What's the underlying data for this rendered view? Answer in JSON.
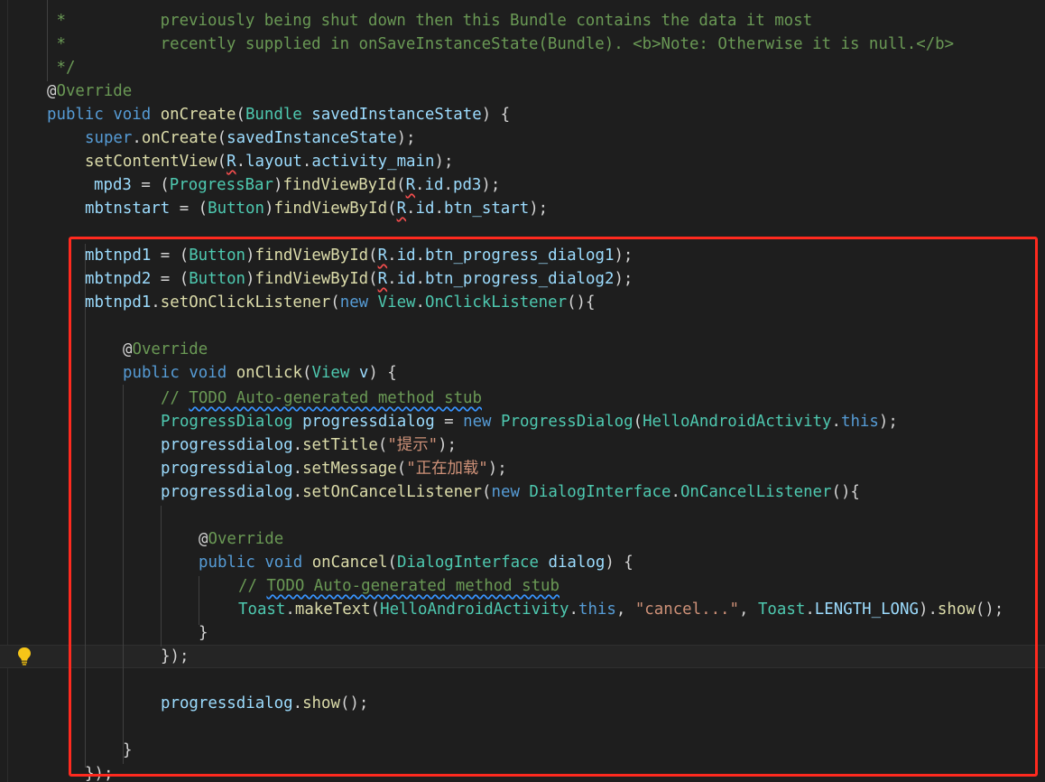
{
  "editor": {
    "lines": [
      [
        {
          "t": " *          previously being shut down then this Bundle contains the data it most",
          "c": "cm"
        }
      ],
      [
        {
          "t": " *          recently supplied in onSaveInstanceState(Bundle). <b>Note: Otherwise it is null.</b>",
          "c": "cm"
        }
      ],
      [
        {
          "t": " */",
          "c": "cm"
        }
      ],
      [
        {
          "t": "@",
          "c": "an"
        },
        {
          "t": "Override",
          "c": "cm"
        }
      ],
      [
        {
          "t": "public",
          "c": "kw"
        },
        {
          "t": " ",
          "c": "pl"
        },
        {
          "t": "void",
          "c": "kw"
        },
        {
          "t": " ",
          "c": "pl"
        },
        {
          "t": "onCreate",
          "c": "fn"
        },
        {
          "t": "(",
          "c": "pl"
        },
        {
          "t": "Bundle",
          "c": "ty"
        },
        {
          "t": " ",
          "c": "pl"
        },
        {
          "t": "savedInstanceState",
          "c": "vr"
        },
        {
          "t": ") {",
          "c": "pl"
        }
      ],
      [
        {
          "t": "super",
          "c": "kw"
        },
        {
          "t": ".",
          "c": "pl"
        },
        {
          "t": "onCreate",
          "c": "fn"
        },
        {
          "t": "(",
          "c": "pl"
        },
        {
          "t": "savedInstanceState",
          "c": "vr"
        },
        {
          "t": ");",
          "c": "pl"
        }
      ],
      [
        {
          "t": "setContentView",
          "c": "fn"
        },
        {
          "t": "(",
          "c": "pl"
        },
        {
          "t": "R",
          "c": "vr",
          "u": "r"
        },
        {
          "t": ".",
          "c": "pl"
        },
        {
          "t": "layout",
          "c": "vr"
        },
        {
          "t": ".",
          "c": "pl"
        },
        {
          "t": "activity_main",
          "c": "vr"
        },
        {
          "t": ");",
          "c": "pl"
        }
      ],
      [
        {
          "t": "mpd3",
          "c": "vr"
        },
        {
          "t": " = (",
          "c": "pl"
        },
        {
          "t": "ProgressBar",
          "c": "ty"
        },
        {
          "t": ")",
          "c": "pl"
        },
        {
          "t": "findViewById",
          "c": "fn"
        },
        {
          "t": "(",
          "c": "pl"
        },
        {
          "t": "R",
          "c": "vr",
          "u": "r"
        },
        {
          "t": ".",
          "c": "pl"
        },
        {
          "t": "id",
          "c": "vr"
        },
        {
          "t": ".",
          "c": "pl"
        },
        {
          "t": "pd3",
          "c": "vr"
        },
        {
          "t": ");",
          "c": "pl"
        }
      ],
      [
        {
          "t": "mbtnstart",
          "c": "vr"
        },
        {
          "t": " = (",
          "c": "pl"
        },
        {
          "t": "Button",
          "c": "ty"
        },
        {
          "t": ")",
          "c": "pl"
        },
        {
          "t": "findViewById",
          "c": "fn"
        },
        {
          "t": "(",
          "c": "pl"
        },
        {
          "t": "R",
          "c": "vr",
          "u": "r"
        },
        {
          "t": ".",
          "c": "pl"
        },
        {
          "t": "id",
          "c": "vr"
        },
        {
          "t": ".",
          "c": "pl"
        },
        {
          "t": "btn_start",
          "c": "vr"
        },
        {
          "t": ");",
          "c": "pl"
        }
      ],
      [],
      [
        {
          "t": "mbtnpd1",
          "c": "vr"
        },
        {
          "t": " = (",
          "c": "pl"
        },
        {
          "t": "Button",
          "c": "ty"
        },
        {
          "t": ")",
          "c": "pl"
        },
        {
          "t": "findViewById",
          "c": "fn"
        },
        {
          "t": "(",
          "c": "pl"
        },
        {
          "t": "R",
          "c": "vr",
          "u": "r"
        },
        {
          "t": ".",
          "c": "pl"
        },
        {
          "t": "id",
          "c": "vr"
        },
        {
          "t": ".",
          "c": "pl"
        },
        {
          "t": "btn_progress_dialog1",
          "c": "vr"
        },
        {
          "t": ");",
          "c": "pl"
        }
      ],
      [
        {
          "t": "mbtnpd2",
          "c": "vr"
        },
        {
          "t": " = (",
          "c": "pl"
        },
        {
          "t": "Button",
          "c": "ty"
        },
        {
          "t": ")",
          "c": "pl"
        },
        {
          "t": "findViewById",
          "c": "fn"
        },
        {
          "t": "(",
          "c": "pl"
        },
        {
          "t": "R",
          "c": "vr",
          "u": "r"
        },
        {
          "t": ".",
          "c": "pl"
        },
        {
          "t": "id",
          "c": "vr"
        },
        {
          "t": ".",
          "c": "pl"
        },
        {
          "t": "btn_progress_dialog2",
          "c": "vr"
        },
        {
          "t": ");",
          "c": "pl"
        }
      ],
      [
        {
          "t": "mbtnpd1",
          "c": "vr"
        },
        {
          "t": ".",
          "c": "pl"
        },
        {
          "t": "setOnClickListener",
          "c": "fn"
        },
        {
          "t": "(",
          "c": "pl"
        },
        {
          "t": "new",
          "c": "kw"
        },
        {
          "t": " ",
          "c": "pl"
        },
        {
          "t": "View",
          "c": "ty"
        },
        {
          "t": ".",
          "c": "pl"
        },
        {
          "t": "OnClickListener",
          "c": "ty"
        },
        {
          "t": "(){",
          "c": "pl"
        }
      ],
      [],
      [
        {
          "t": "@",
          "c": "an"
        },
        {
          "t": "Override",
          "c": "cm"
        }
      ],
      [
        {
          "t": "public",
          "c": "kw"
        },
        {
          "t": " ",
          "c": "pl"
        },
        {
          "t": "void",
          "c": "kw"
        },
        {
          "t": " ",
          "c": "pl"
        },
        {
          "t": "onClick",
          "c": "fn"
        },
        {
          "t": "(",
          "c": "pl"
        },
        {
          "t": "View",
          "c": "ty"
        },
        {
          "t": " ",
          "c": "pl"
        },
        {
          "t": "v",
          "c": "vr"
        },
        {
          "t": ") {",
          "c": "pl"
        }
      ],
      [
        {
          "t": "// ",
          "c": "cm"
        },
        {
          "t": "TODO Auto-generated method stub",
          "c": "cm",
          "u": "b"
        }
      ],
      [
        {
          "t": "ProgressDialog",
          "c": "ty"
        },
        {
          "t": " ",
          "c": "pl"
        },
        {
          "t": "progressdialog",
          "c": "vr"
        },
        {
          "t": " = ",
          "c": "pl"
        },
        {
          "t": "new",
          "c": "kw"
        },
        {
          "t": " ",
          "c": "pl"
        },
        {
          "t": "ProgressDialog",
          "c": "ty"
        },
        {
          "t": "(",
          "c": "pl"
        },
        {
          "t": "HelloAndroidActivity",
          "c": "ty"
        },
        {
          "t": ".",
          "c": "pl"
        },
        {
          "t": "this",
          "c": "kw"
        },
        {
          "t": ");",
          "c": "pl"
        }
      ],
      [
        {
          "t": "progressdialog",
          "c": "vr"
        },
        {
          "t": ".",
          "c": "pl"
        },
        {
          "t": "setTitle",
          "c": "fn"
        },
        {
          "t": "(",
          "c": "pl"
        },
        {
          "t": "\"提示\"",
          "c": "st"
        },
        {
          "t": ");",
          "c": "pl"
        }
      ],
      [
        {
          "t": "progressdialog",
          "c": "vr"
        },
        {
          "t": ".",
          "c": "pl"
        },
        {
          "t": "setMessage",
          "c": "fn"
        },
        {
          "t": "(",
          "c": "pl"
        },
        {
          "t": "\"正在加载\"",
          "c": "st"
        },
        {
          "t": ");",
          "c": "pl"
        }
      ],
      [
        {
          "t": "progressdialog",
          "c": "vr"
        },
        {
          "t": ".",
          "c": "pl"
        },
        {
          "t": "setOnCancelListener",
          "c": "fn"
        },
        {
          "t": "(",
          "c": "pl"
        },
        {
          "t": "new",
          "c": "kw"
        },
        {
          "t": " ",
          "c": "pl"
        },
        {
          "t": "DialogInterface",
          "c": "ty"
        },
        {
          "t": ".",
          "c": "pl"
        },
        {
          "t": "OnCancelListener",
          "c": "ty"
        },
        {
          "t": "(){",
          "c": "pl"
        }
      ],
      [],
      [
        {
          "t": "@",
          "c": "an"
        },
        {
          "t": "Override",
          "c": "cm"
        }
      ],
      [
        {
          "t": "public",
          "c": "kw"
        },
        {
          "t": " ",
          "c": "pl"
        },
        {
          "t": "void",
          "c": "kw"
        },
        {
          "t": " ",
          "c": "pl"
        },
        {
          "t": "onCancel",
          "c": "fn"
        },
        {
          "t": "(",
          "c": "pl"
        },
        {
          "t": "DialogInterface",
          "c": "ty"
        },
        {
          "t": " ",
          "c": "pl"
        },
        {
          "t": "dialog",
          "c": "vr"
        },
        {
          "t": ") {",
          "c": "pl"
        }
      ],
      [
        {
          "t": "// ",
          "c": "cm"
        },
        {
          "t": "TODO Auto-generated method stub",
          "c": "cm",
          "u": "b"
        }
      ],
      [
        {
          "t": "Toast",
          "c": "ty"
        },
        {
          "t": ".",
          "c": "pl"
        },
        {
          "t": "makeText",
          "c": "fn"
        },
        {
          "t": "(",
          "c": "pl"
        },
        {
          "t": "HelloAndroidActivity",
          "c": "ty"
        },
        {
          "t": ".",
          "c": "pl"
        },
        {
          "t": "this",
          "c": "kw"
        },
        {
          "t": ", ",
          "c": "pl"
        },
        {
          "t": "\"cancel...\"",
          "c": "st"
        },
        {
          "t": ", ",
          "c": "pl"
        },
        {
          "t": "Toast",
          "c": "ty"
        },
        {
          "t": ".",
          "c": "pl"
        },
        {
          "t": "LENGTH_LONG",
          "c": "vr"
        },
        {
          "t": ").",
          "c": "pl"
        },
        {
          "t": "show",
          "c": "fn"
        },
        {
          "t": "();",
          "c": "pl"
        }
      ],
      [
        {
          "t": "}",
          "c": "pl"
        }
      ],
      [
        {
          "t": "});",
          "c": "pl"
        }
      ],
      [],
      [
        {
          "t": "progressdialog",
          "c": "vr"
        },
        {
          "t": ".",
          "c": "pl"
        },
        {
          "t": "show",
          "c": "fn"
        },
        {
          "t": "();",
          "c": "pl"
        }
      ],
      [],
      [
        {
          "t": "}",
          "c": "pl"
        }
      ],
      [
        {
          "t": "});",
          "c": "pl"
        }
      ]
    ],
    "lightbulb_icon": "lightbulb-icon",
    "highlight_color": "#ff2a1f"
  }
}
